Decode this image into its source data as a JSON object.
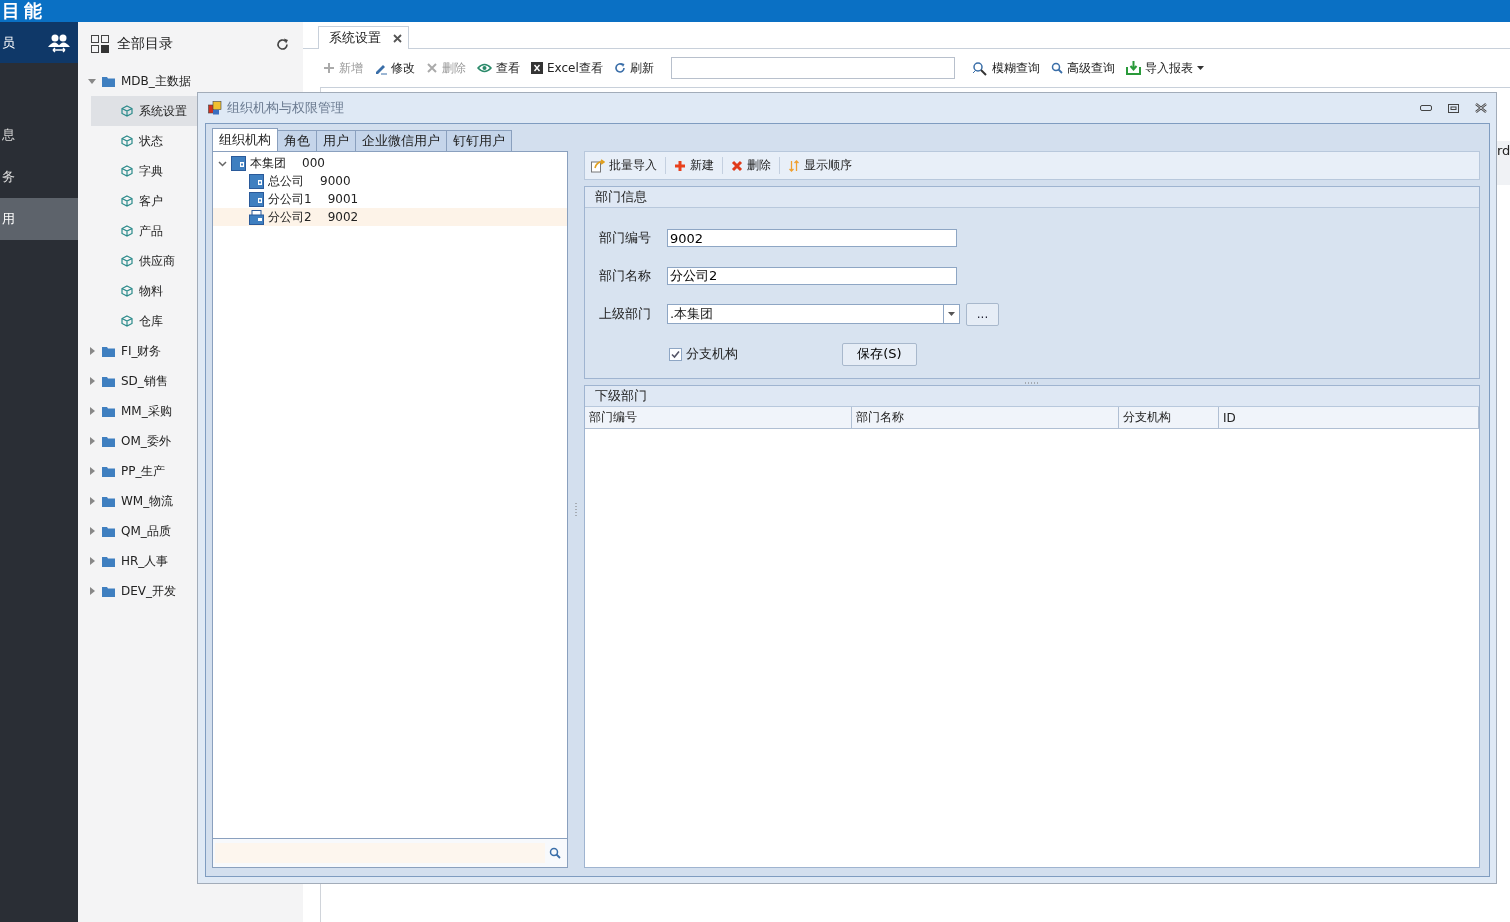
{
  "header": {
    "title": "目能"
  },
  "nav": {
    "header_label": "员",
    "items": [
      {
        "label": "息",
        "selected": false
      },
      {
        "label": "务",
        "selected": false
      },
      {
        "label": "用",
        "selected": true
      }
    ]
  },
  "catalog": {
    "title": "全部目录",
    "tree": [
      {
        "label": "MDB_主数据",
        "expanded": true,
        "children": [
          {
            "label": "系统设置",
            "selected": true
          },
          {
            "label": "状态",
            "selected": false
          },
          {
            "label": "字典",
            "selected": false
          },
          {
            "label": "客户",
            "selected": false
          },
          {
            "label": "产品",
            "selected": false
          },
          {
            "label": "供应商",
            "selected": false
          },
          {
            "label": "物料",
            "selected": false
          },
          {
            "label": "仓库",
            "selected": false
          }
        ]
      },
      {
        "label": "FI_财务",
        "expanded": false
      },
      {
        "label": "SD_销售",
        "expanded": false
      },
      {
        "label": "MM_采购",
        "expanded": false
      },
      {
        "label": "OM_委外",
        "expanded": false
      },
      {
        "label": "PP_生产",
        "expanded": false
      },
      {
        "label": "WM_物流",
        "expanded": false
      },
      {
        "label": "QM_品质",
        "expanded": false
      },
      {
        "label": "HR_人事",
        "expanded": false
      },
      {
        "label": "DEV_开发",
        "expanded": false
      }
    ]
  },
  "tabs": [
    {
      "label": "系统设置",
      "selected": true
    }
  ],
  "toolbar": {
    "left": [
      {
        "label": "新增",
        "kind": "add",
        "disabled": true
      },
      {
        "label": "修改",
        "kind": "edit",
        "disabled": false
      },
      {
        "label": "删除",
        "kind": "delete",
        "disabled": true
      },
      {
        "label": "查看",
        "kind": "view",
        "disabled": false
      },
      {
        "label": "Excel查看",
        "kind": "excel",
        "disabled": false
      },
      {
        "label": "刷新",
        "kind": "refresh",
        "disabled": false
      }
    ],
    "right": [
      {
        "label": "模糊查询",
        "kind": "fuzzy"
      },
      {
        "label": "高级查询",
        "kind": "search"
      },
      {
        "label": "导入报表",
        "kind": "import"
      }
    ]
  },
  "edge_text": "rd",
  "dialog": {
    "title": "组织机构与权限管理",
    "tabs": [
      {
        "label": "组织机构",
        "selected": true
      },
      {
        "label": "角色",
        "selected": false
      },
      {
        "label": "用户",
        "selected": false
      },
      {
        "label": "企业微信用户",
        "selected": false
      },
      {
        "label": "钉钉用户",
        "selected": false
      }
    ],
    "tree": [
      {
        "label": "本集团",
        "code": "000",
        "expanded": true,
        "selected": false,
        "children": [
          {
            "label": "总公司",
            "code": "9000",
            "selected": false
          },
          {
            "label": "分公司1",
            "code": "9001",
            "selected": false
          },
          {
            "label": "分公司2",
            "code": "9002",
            "selected": true
          }
        ]
      }
    ],
    "toolbar": [
      {
        "label": "批量导入",
        "kind": "import"
      },
      {
        "label": "新建",
        "kind": "add"
      },
      {
        "label": "删除",
        "kind": "delete"
      },
      {
        "label": "显示顺序",
        "kind": "order"
      }
    ],
    "dept_info": {
      "title": "部门信息",
      "fields": [
        {
          "label": "部门编号",
          "value": "9002",
          "kind": "text"
        },
        {
          "label": "部门名称",
          "value": "分公司2",
          "kind": "text"
        },
        {
          "label": "上级部门",
          "value": ".本集团",
          "kind": "combo",
          "button": "..."
        }
      ],
      "branch": {
        "label": "分支机构",
        "checked": true
      },
      "save": "保存(S)"
    },
    "sub_depts": {
      "title": "下级部门",
      "columns": [
        "部门编号",
        "部门名称",
        "分支机构",
        "ID"
      ]
    }
  }
}
